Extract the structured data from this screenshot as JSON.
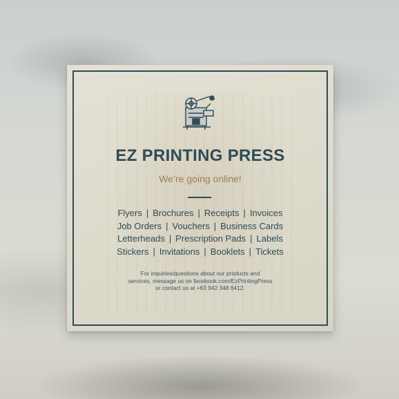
{
  "card": {
    "title": "EZ PRINTING PRESS",
    "subtitle": "We’re going online!",
    "icon": "printing-press-icon",
    "services": [
      [
        "Flyers",
        "Brochures",
        "Receipts",
        "Invoices"
      ],
      [
        "Job Orders",
        "Vouchers",
        "Business Cards"
      ],
      [
        "Letterheads",
        "Prescription Pads",
        "Labels"
      ],
      [
        "Stickers",
        "Invitations",
        "Booklets",
        "Tickets"
      ]
    ],
    "separator": "|",
    "contact": [
      "For inquiries/questions about our products and",
      "services, message us on facebook.com/EzPrintingPress",
      "or contact us at +63 942 348 6412."
    ]
  },
  "colors": {
    "primary": "#2e4a56",
    "accent": "#9a7f5c",
    "paper": "#e0ddd0"
  }
}
